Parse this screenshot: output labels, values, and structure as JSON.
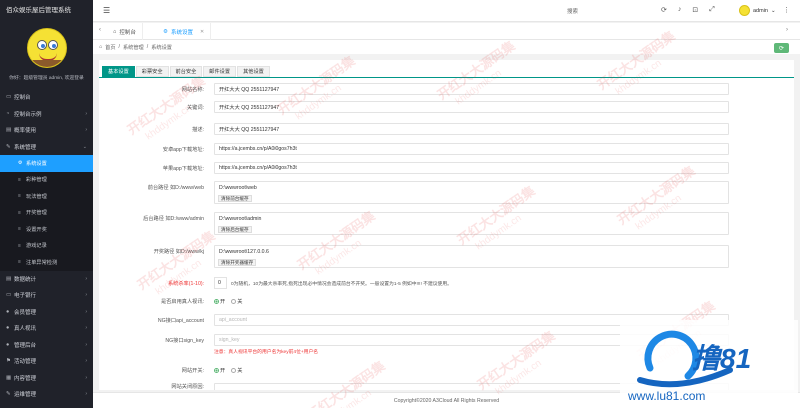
{
  "app": {
    "title": "佰众娱乐屋后管理系统"
  },
  "sidebar": {
    "welcome": "你好：超级管理员 admin, 欢迎登录",
    "items": [
      {
        "label": "控制台",
        "icon": "monitor-icon",
        "type": "item"
      },
      {
        "label": "控制台示例",
        "icon": "dashboard-icon",
        "type": "item",
        "caret": "›"
      },
      {
        "label": "概率使用",
        "icon": "chart-icon",
        "type": "item",
        "caret": "›"
      },
      {
        "label": "系统管理",
        "icon": "wrench-icon",
        "type": "item",
        "caret": "⌄"
      },
      {
        "label": "系统设置",
        "icon": "gear-icon",
        "type": "sub",
        "active": true
      },
      {
        "label": "彩种管理",
        "icon": "list-icon",
        "type": "sub"
      },
      {
        "label": "玩法管理",
        "icon": "list-icon",
        "type": "sub"
      },
      {
        "label": "开奖管理",
        "icon": "list-icon",
        "type": "sub"
      },
      {
        "label": "设置开奖",
        "icon": "list-icon",
        "type": "sub"
      },
      {
        "label": "游戏记录",
        "icon": "list-icon",
        "type": "sub"
      },
      {
        "label": "注单异常检测",
        "icon": "list-icon",
        "type": "sub"
      },
      {
        "label": "数据统计",
        "icon": "chart-icon",
        "type": "item",
        "caret": "›"
      },
      {
        "label": "电子银行",
        "icon": "card-icon",
        "type": "item",
        "caret": "›"
      },
      {
        "label": "会员管理",
        "icon": "user-icon",
        "type": "item",
        "caret": "›"
      },
      {
        "label": "真人视讯",
        "icon": "user-icon",
        "type": "item",
        "caret": "›"
      },
      {
        "label": "管理后台",
        "icon": "user-icon",
        "type": "item",
        "caret": "›"
      },
      {
        "label": "活动管理",
        "icon": "flag-icon",
        "type": "item",
        "caret": "›"
      },
      {
        "label": "内容管理",
        "icon": "doc-icon",
        "type": "item",
        "caret": "›"
      },
      {
        "label": "运维管理",
        "icon": "wrench-icon",
        "type": "item",
        "caret": "›"
      }
    ]
  },
  "header": {
    "menu_icon": "☰",
    "search": "搜索",
    "user": "admin",
    "user_caret": "⌄"
  },
  "tabs": [
    {
      "label": "控制台",
      "icon": "home-icon"
    },
    {
      "label": "系统设置",
      "icon": "gear-icon",
      "close": "✕"
    }
  ],
  "breadcrumb": {
    "home": "首页",
    "sep": "/",
    "level1": "系统管理",
    "level2": "系统设置"
  },
  "subtabs": [
    "基本设置",
    "彩票安全",
    "前台安全",
    "邮件设置",
    "其他设置"
  ],
  "form": {
    "site_name": {
      "label": "网站名称:",
      "value": "开红大大 QQ 2551127947"
    },
    "keywords": {
      "label": "关键词:",
      "value": "开红大大 QQ 2551127947"
    },
    "description": {
      "label": "描述:",
      "value": "开红大大 QQ 2551127947"
    },
    "android_url": {
      "label": "安卓app下载地址:",
      "value": "https://a.jcembs.cn/p/A0i0gos7h3t"
    },
    "ios_url": {
      "label": "苹果app下载地址:",
      "value": "https://a.jcembs.cn/p/A0i0gos7h3t"
    },
    "front_path": {
      "label": "前台路径 如D:/www/web",
      "value": "D:\\wwwroot\\web",
      "button": "清除前台缓存"
    },
    "admin_path": {
      "label": "后台路径 如D:/www/admin",
      "value": "D:\\wwwroot\\admin",
      "button": "清除后台缓存"
    },
    "draw_path": {
      "label": "开奖路径 如D:/www/kj",
      "value": "D:\\wwwroot\\127.0.0.6",
      "button": "清除开奖器缓存"
    },
    "kill_rate": {
      "label": "系统杀率(1-10):",
      "value": "0",
      "hint": "0为随机，10为最大杀率死,指死出现必中情况会造成前台不开奖。一般设置为1-5 例如中!!!! 不建议使用。"
    },
    "live_enable": {
      "label": "是否启用真人视讯:",
      "on": "开",
      "off": "关"
    },
    "ng_account": {
      "label": "NG接口api_account",
      "placeholder": "api_account"
    },
    "ng_sign": {
      "label": "NG接口sign_key",
      "placeholder": "sign_key",
      "warning": "注意：真人视讯平台的用户名为key前4位+用户名"
    },
    "site_switch": {
      "label": "网站开关:",
      "on": "开",
      "off": "关"
    },
    "close_reason": {
      "label": "网站关闭原因:"
    }
  },
  "footer": "Copyright©2020 A3Cloud All Rights Reserved",
  "watermark": {
    "cn": "开红大大源码集",
    "en": "khddymk.cn"
  },
  "logo": {
    "text": "撸81",
    "url": "www.lu81.com"
  },
  "colors": {
    "sidebar": "#20222a",
    "active": "#1e9fff",
    "teal": "#009688",
    "green": "#5fb878",
    "warn": "#ee3333"
  }
}
